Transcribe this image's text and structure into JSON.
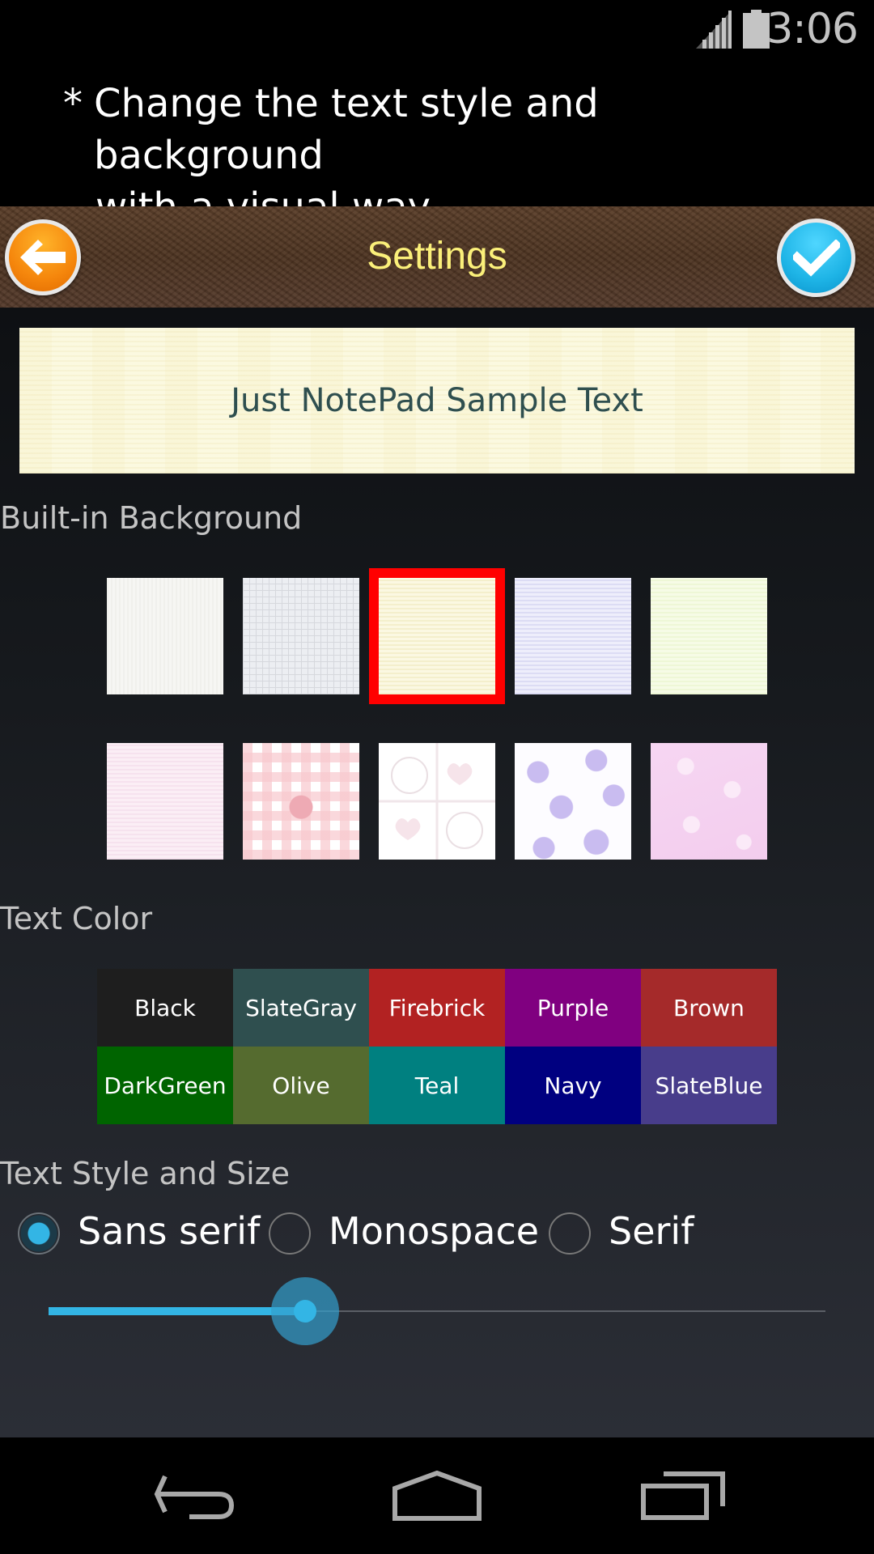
{
  "status_bar": {
    "time": "3:06",
    "icons": [
      "signal-icon",
      "battery-icon"
    ]
  },
  "caption": {
    "star": "*",
    "line1": "Change the text style and background",
    "line2": "with a visual way."
  },
  "header": {
    "title": "Settings",
    "back_icon": "back-arrow-icon",
    "confirm_icon": "checkmark-icon"
  },
  "preview": {
    "text": "Just NotePad Sample Text",
    "text_color": "#2f4f4f",
    "background": "cream-paper"
  },
  "backgrounds": {
    "label": "Built-in Background",
    "selected_index": 2,
    "selection_color": "#ff0000",
    "items": [
      {
        "name": "white-paper"
      },
      {
        "name": "gray-grid"
      },
      {
        "name": "cream-paper"
      },
      {
        "name": "lavender-paper"
      },
      {
        "name": "light-green-paper"
      },
      {
        "name": "pink-paper"
      },
      {
        "name": "pink-gingham-flower"
      },
      {
        "name": "bear-hearts"
      },
      {
        "name": "purple-flowers"
      },
      {
        "name": "pink-sakura"
      }
    ]
  },
  "text_colors": {
    "label": "Text Color",
    "items": [
      {
        "label": "Black",
        "color": "#1e1e1e"
      },
      {
        "label": "SlateGray",
        "color": "#2f4f4f"
      },
      {
        "label": "Firebrick",
        "color": "#b22222"
      },
      {
        "label": "Purple",
        "color": "#800080"
      },
      {
        "label": "Brown",
        "color": "#a52a2a"
      },
      {
        "label": "DarkGreen",
        "color": "#006400"
      },
      {
        "label": "Olive",
        "color": "#556b2f"
      },
      {
        "label": "Teal",
        "color": "#008080"
      },
      {
        "label": "Navy",
        "color": "#000080"
      },
      {
        "label": "SlateBlue",
        "color": "#483d8b"
      }
    ]
  },
  "text_style": {
    "label": "Text Style and Size",
    "options": [
      {
        "label": "Sans serif",
        "checked": true
      },
      {
        "label": "Monospace",
        "checked": false
      },
      {
        "label": "Serif",
        "checked": false
      }
    ],
    "size_fraction": 0.33,
    "accent_color": "#33b5e5"
  },
  "nav_bar": {
    "icons": [
      "back-icon",
      "home-icon",
      "recents-icon"
    ]
  }
}
